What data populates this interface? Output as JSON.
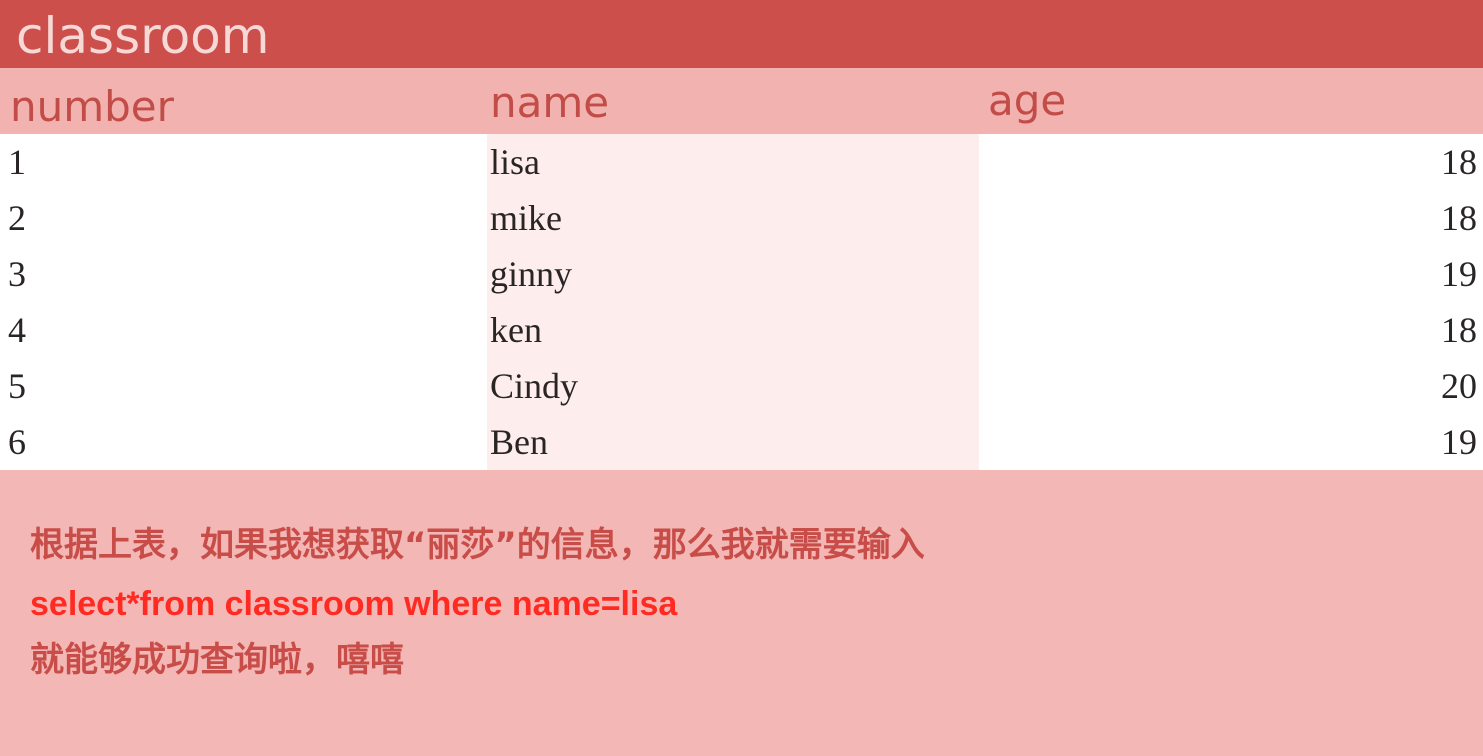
{
  "table_title": "classroom",
  "columns": {
    "number": "number",
    "name": "name",
    "age": "age"
  },
  "rows": [
    {
      "number": "1",
      "name": "lisa",
      "age": "18"
    },
    {
      "number": "2",
      "name": "mike",
      "age": "18"
    },
    {
      "number": "3",
      "name": "ginny",
      "age": "19"
    },
    {
      "number": "4",
      "name": "ken",
      "age": "18"
    },
    {
      "number": "5",
      "name": "Cindy",
      "age": "20"
    },
    {
      "number": "6",
      "name": "Ben",
      "age": "19"
    }
  ],
  "notes": {
    "line1": "根据上表，如果我想获取“丽莎”的信息，那么我就需要输入",
    "line2": "select*from classroom where name=lisa",
    "line3": "就能够成功查询啦，嘻嘻"
  },
  "colors": {
    "title_bar": "#cc4f4b",
    "background": "#f3b7b5",
    "query_text": "#ff2b22",
    "note_text": "#c84d49"
  }
}
